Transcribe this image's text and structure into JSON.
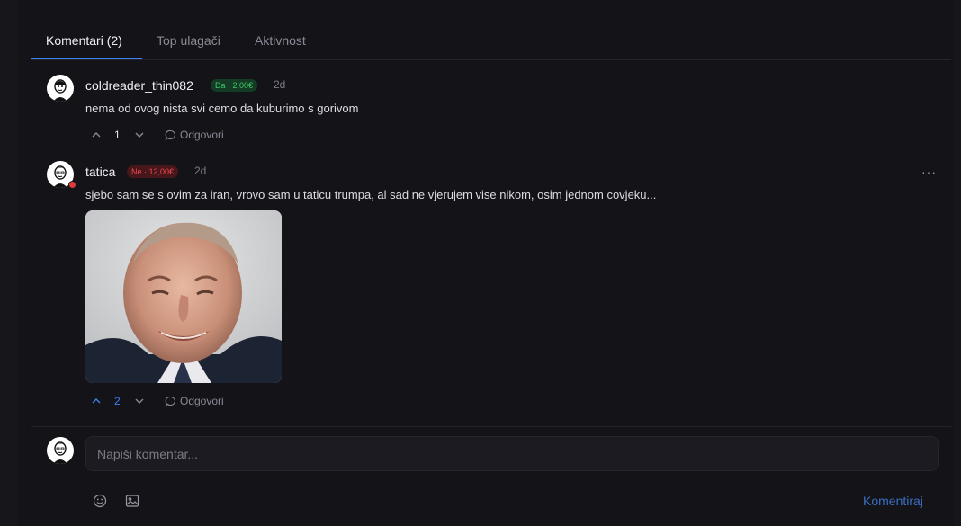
{
  "tabs": [
    {
      "label": "Komentari (2)",
      "active": true
    },
    {
      "label": "Top ulagači",
      "active": false
    },
    {
      "label": "Aktivnost",
      "active": false
    }
  ],
  "comments": [
    {
      "username": "coldreader_thin082",
      "badge": "Da · 2,00€",
      "badge_type": "yes",
      "time": "2d",
      "text": "nema od ovog nista svi cemo da kuburimo s gorivom",
      "votes": "1",
      "reply_label": "Odgovori"
    },
    {
      "username": "tatica",
      "badge": "Ne · 12,00€",
      "badge_type": "no",
      "time": "2d",
      "text": "sjebo sam se s ovim za iran, vrovo sam u taticu trumpa, al sad ne vjerujem vise nikom, osim jednom covjeku...",
      "votes": "2",
      "upvoted": true,
      "reply_label": "Odgovori",
      "more_label": "···",
      "has_image": true
    }
  ],
  "composer": {
    "placeholder": "Napiši komentar...",
    "submit_label": "Komentiraj",
    "emoji_icon": "emoji-icon",
    "image_icon": "image-icon"
  },
  "colors": {
    "accent": "#3b82f6",
    "yes": "#3fc76b",
    "no": "#ef4a52",
    "background": "#131318"
  }
}
